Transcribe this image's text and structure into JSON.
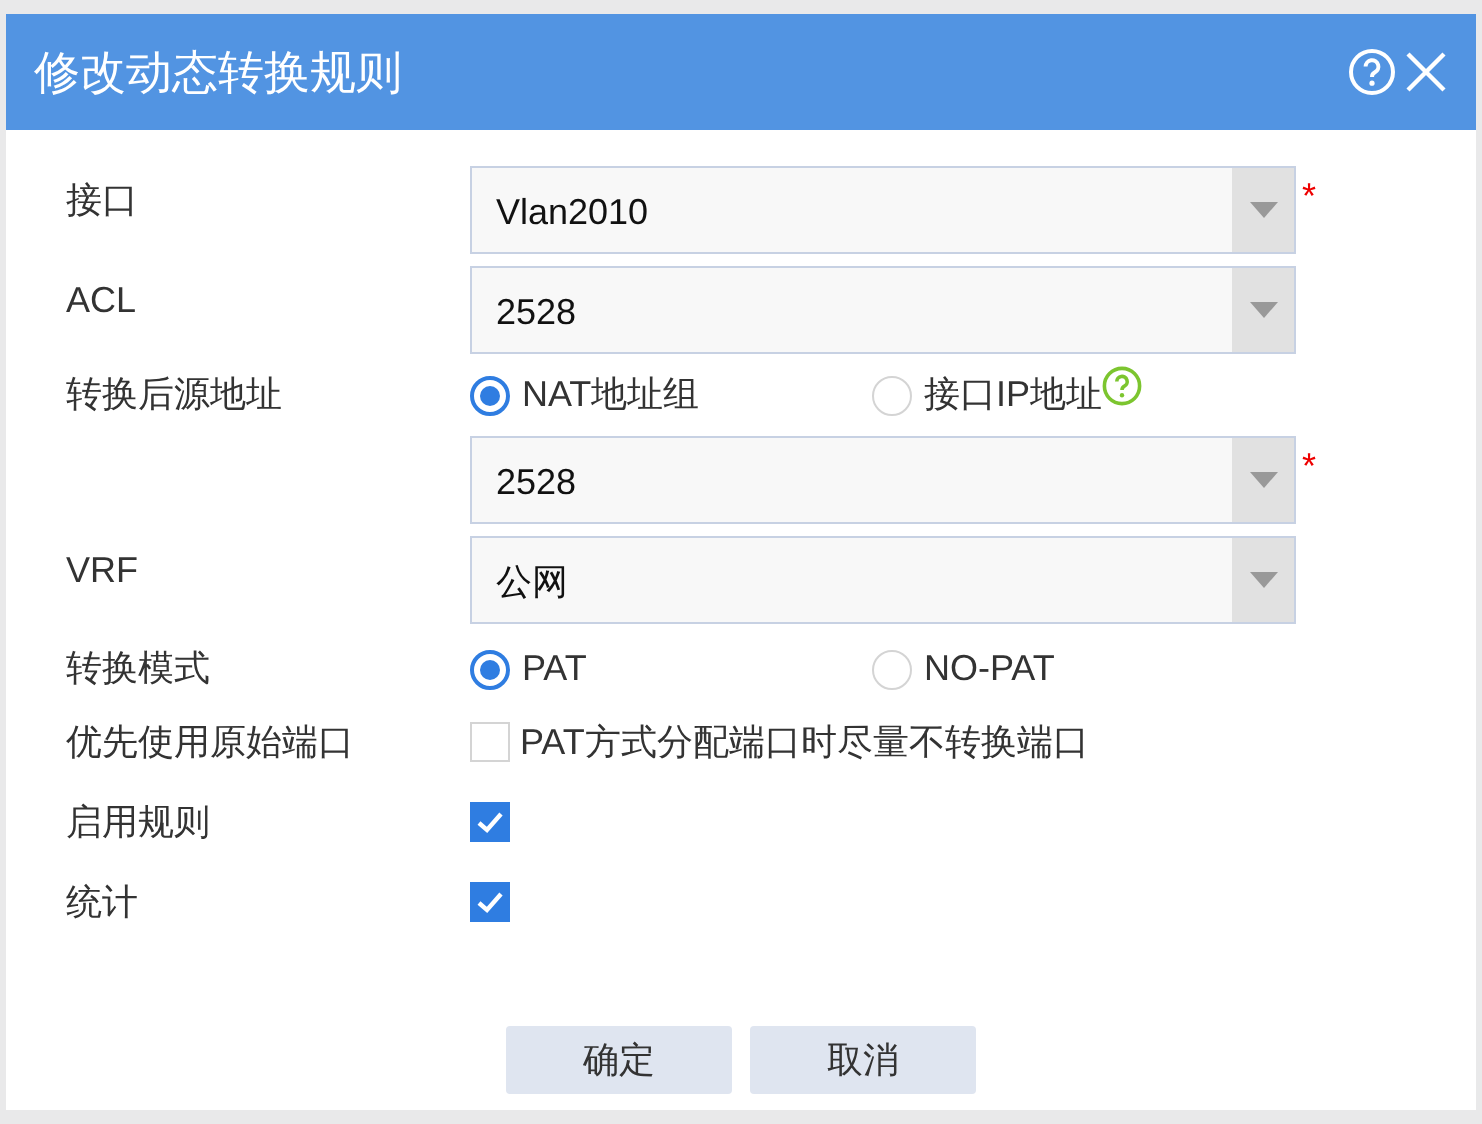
{
  "dialog": {
    "title": "修改动态转换规则"
  },
  "rows": [
    {
      "kind": "select",
      "label": "接口",
      "value": "Vlan2010",
      "required_mark": "*"
    },
    {
      "kind": "select",
      "label": "ACL",
      "value": "2528"
    },
    {
      "kind": "radio",
      "label": "转换后源地址",
      "options": [
        {
          "label": "NAT地址组",
          "selected": true,
          "help": false
        },
        {
          "label": "接口IP地址",
          "selected": false,
          "help": true
        }
      ]
    },
    {
      "kind": "select",
      "value": "2528",
      "required_mark": "*"
    },
    {
      "kind": "select",
      "label": "VRF",
      "value": "公网"
    },
    {
      "kind": "radio",
      "label": "转换模式",
      "options": [
        {
          "label": "PAT",
          "selected": true,
          "help": false
        },
        {
          "label": "NO-PAT",
          "selected": false,
          "help": false
        }
      ]
    },
    {
      "kind": "checkbox",
      "label": "优先使用原始端口",
      "text": "PAT方式分配端口时尽量不转换端口",
      "checked": false
    },
    {
      "kind": "checkbox",
      "label": "启用规则",
      "checked": true
    },
    {
      "kind": "checkbox",
      "label": "统计",
      "checked": true
    }
  ],
  "buttons": [
    "确定",
    "取消"
  ]
}
